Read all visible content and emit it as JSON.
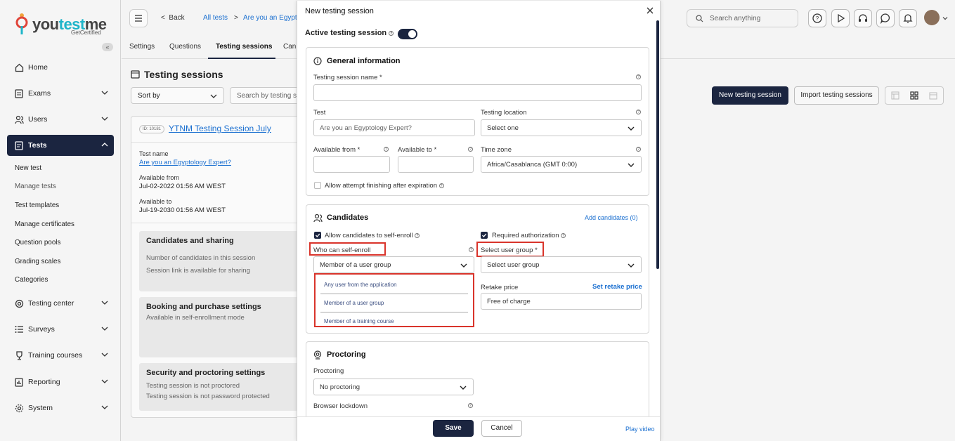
{
  "logo": {
    "brand_part1": "you",
    "brand_part2": "test",
    "brand_part3": "me",
    "tagline": "GetCertified"
  },
  "sidebar": {
    "items": [
      {
        "label": "Home"
      },
      {
        "label": "Exams"
      },
      {
        "label": "Users"
      },
      {
        "label": "Tests"
      },
      {
        "label": "Testing center"
      },
      {
        "label": "Surveys"
      },
      {
        "label": "Training courses"
      },
      {
        "label": "Reporting"
      },
      {
        "label": "System"
      }
    ],
    "tests_sub": [
      "New test",
      "Manage tests",
      "Test templates",
      "Manage certificates",
      "Question pools",
      "Grading scales",
      "Categories"
    ]
  },
  "topbar": {
    "back": "Back",
    "crumb1": "All tests",
    "crumb_sep": ">",
    "crumb2": "Are you an Egypt",
    "search_placeholder": "Search anything"
  },
  "tabs": [
    "Settings",
    "Questions",
    "Testing sessions",
    "Can"
  ],
  "page": {
    "title": "Testing sessions",
    "sort_label": "Sort by",
    "search_placeholder": "Search by testing se",
    "new_session": "New testing session",
    "import_sessions": "Import testing sessions"
  },
  "card": {
    "id_badge": "ID: 10181",
    "session_title": "YTNM Testing Session July",
    "test_name_label": "Test name",
    "test_name": "Are you an Egyptology Expert?",
    "available_from_label": "Available from",
    "available_from": "Jul-02-2022 01:56 AM WEST",
    "available_to_label": "Available to",
    "available_to": "Jul-19-2030 01:56 AM WEST",
    "cands_title": "Candidates and sharing",
    "cands_line1": "Number of candidates in this session",
    "cands_line2": "Session link is available for sharing",
    "booking_title": "Booking and purchase settings",
    "booking_line1": "Available in self-enrollment mode",
    "security_title": "Security and proctoring settings",
    "security_line1": "Testing session is not proctored",
    "security_line2": "Testing session is not password protected"
  },
  "modal": {
    "title": "New testing session",
    "active_label": "Active testing session",
    "general": {
      "title": "General information",
      "name_label": "Testing session name",
      "req": "*",
      "test_label": "Test",
      "test_placeholder": "Are you an Egyptology Expert?",
      "location_label": "Testing location",
      "location_value": "Select one",
      "from_label": "Available from",
      "to_label": "Available to",
      "tz_label": "Time zone",
      "tz_value": "Africa/Casablanca (GMT 0:00)",
      "allow_after_exp": "Allow attempt finishing after expiration"
    },
    "candidates": {
      "title": "Candidates",
      "add_link": "Add candidates (0)",
      "self_enroll": "Allow candidates to self-enroll",
      "required_auth": "Required authorization",
      "who_label": "Who can self-enroll",
      "who_value": "Member of a user group",
      "group_label": "Select user group",
      "group_value": "Select user group",
      "retake_label": "Retake price",
      "retake_link": "Set retake price",
      "retake_value": "Free of charge",
      "options": [
        "Any user from the application",
        "Member of a user group",
        "Member of a training course"
      ]
    },
    "proctoring": {
      "title": "Proctoring",
      "label": "Proctoring",
      "value": "No proctoring",
      "lockdown_label": "Browser lockdown"
    },
    "save": "Save",
    "cancel": "Cancel",
    "play_video": "Play video"
  },
  "colors": {
    "navy": "#1b2540",
    "link": "#1a6fd0",
    "highlight": "#d9342b"
  }
}
